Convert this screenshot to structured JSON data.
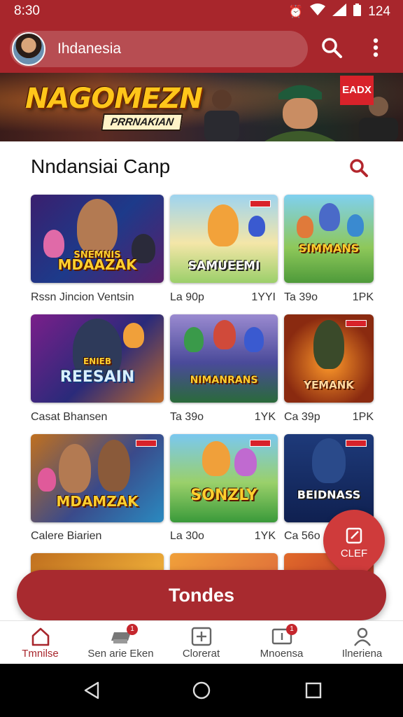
{
  "status_bar": {
    "time": "8:30",
    "battery_text": "124"
  },
  "header": {
    "region": "Ihdanesia"
  },
  "banner": {
    "title": "NAGOMEZN",
    "subtitle": "PRRNAKIAN",
    "badge": "EADX"
  },
  "section": {
    "title": "Nndansiai Canp"
  },
  "games": [
    {
      "art_title": "MDAAZAK",
      "art_top": "SNEMNIS",
      "meta_left": "Rssn Jincion Ventsin",
      "meta_right": ""
    },
    {
      "art_title": "SAMUEEMI",
      "art_top": "",
      "meta_left": "La 90p",
      "meta_right": "1YYI"
    },
    {
      "art_title": "SIMMANS",
      "art_top": "",
      "meta_left": "Ta 39o",
      "meta_right": "1PK"
    },
    {
      "art_title": "REESAIN",
      "art_top": "ENIEB",
      "meta_left": "Casat Bhansen",
      "meta_right": ""
    },
    {
      "art_title": "NIMANRANS",
      "art_top": "",
      "meta_left": "Ta 39o",
      "meta_right": "1YK"
    },
    {
      "art_title": "YEMANK",
      "art_top": "",
      "meta_left": "Ca 39p",
      "meta_right": "1PK"
    },
    {
      "art_title": "MDAMZAK",
      "art_top": "",
      "meta_left": "Calere Biarien",
      "meta_right": ""
    },
    {
      "art_title": "SONZLY",
      "art_top": "",
      "meta_left": "La 30o",
      "meta_right": "1YK"
    },
    {
      "art_title": "BEIDNASS",
      "art_top": "",
      "meta_left": "Ca 56o",
      "meta_right": ""
    }
  ],
  "fab": {
    "label": "CLEF"
  },
  "cta": {
    "label": "Tondes"
  },
  "bottom_nav": [
    {
      "label": "Tmnilse",
      "icon": "home-icon",
      "active": true,
      "badge": ""
    },
    {
      "label": "Sen arie Eken",
      "icon": "controller-icon",
      "active": false,
      "badge": "1"
    },
    {
      "label": "Clorerat",
      "icon": "plus-square-icon",
      "active": false,
      "badge": ""
    },
    {
      "label": "Mnoensa",
      "icon": "inbox-icon",
      "active": false,
      "badge": "1"
    },
    {
      "label": "Ilneriena",
      "icon": "person-icon",
      "active": false,
      "badge": ""
    }
  ],
  "colors": {
    "brand": "#a8262c",
    "accent": "#cf3b3b",
    "title_gold": "#ffc61a"
  }
}
